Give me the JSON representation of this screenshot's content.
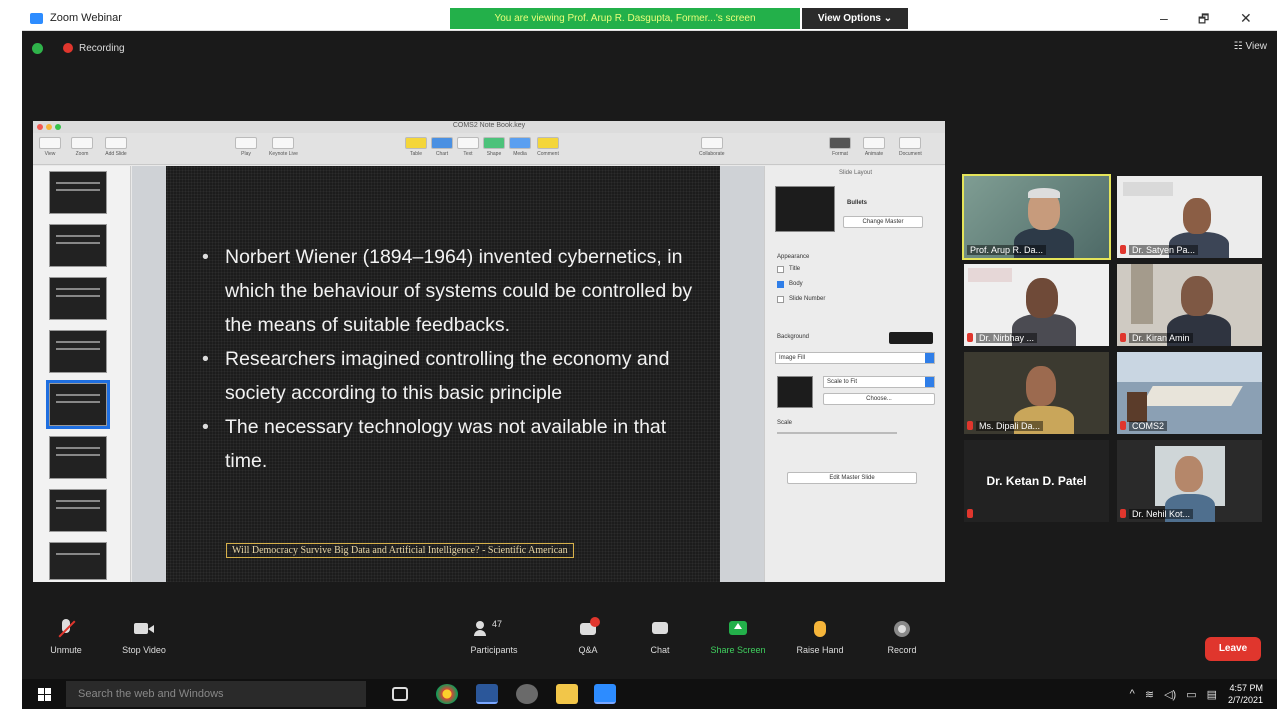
{
  "window": {
    "title": "Zoom Webinar",
    "banner": "You are viewing Prof. Arup R. Dasgupta, Former...'s screen",
    "view_options": "View Options ⌄",
    "minimize": "–",
    "maximize": "🗗",
    "close": "✕"
  },
  "status": {
    "recording": "Recording",
    "view": "☷ View"
  },
  "keynote": {
    "file_title": "COMS2 Note Book.key",
    "toolbar": [
      {
        "label": "View"
      },
      {
        "label": "Zoom"
      },
      {
        "label": "Add Slide"
      },
      {
        "label": "Play"
      },
      {
        "label": "Keynote Live"
      },
      {
        "label": "Table"
      },
      {
        "label": "Chart"
      },
      {
        "label": "Text"
      },
      {
        "label": "Shape"
      },
      {
        "label": "Media"
      },
      {
        "label": "Comment"
      },
      {
        "label": "Collaborate"
      },
      {
        "label": "Format"
      },
      {
        "label": "Animate"
      },
      {
        "label": "Document"
      }
    ],
    "slide": {
      "bullets": [
        "Norbert Wiener (1894–1964) invented cybernetics, in which the behaviour of systems could be controlled by the means of suitable feedbacks.",
        "Researchers imagined controlling the economy and society according to this basic principle",
        "The necessary technology was not available in that time."
      ],
      "citation": "Will Democracy Survive Big Data and Artificial Intelligence? - Scientific American"
    },
    "inspector": {
      "header": "Slide Layout",
      "master_name": "Bullets",
      "change_master": "Change Master",
      "appearance": "Appearance",
      "title": "Title",
      "body": "Body",
      "slide_number": "Slide Number",
      "background": "Background",
      "fill": "Image Fill",
      "scale": "Scale to Fit",
      "choose": "Choose...",
      "scale_label": "Scale",
      "edit_master": "Edit Master Slide"
    }
  },
  "participants": [
    {
      "name": "Prof. Arup R. Da..."
    },
    {
      "name": "Dr. Satyen Pa..."
    },
    {
      "name": "Dr. Nirbhay ..."
    },
    {
      "name": "Dr. Kiran Amin"
    },
    {
      "name": "Ms. Dipali Da..."
    },
    {
      "name": "COMS2"
    },
    {
      "name": "Dr. Ketan D. Patel"
    },
    {
      "name": "Dr. Nehil Kot..."
    }
  ],
  "controls": {
    "unmute": "Unmute",
    "stop_video": "Stop Video",
    "participants": "Participants",
    "participant_count": "47",
    "qa": "Q&A",
    "chat": "Chat",
    "share_screen": "Share Screen",
    "raise_hand": "Raise Hand",
    "record": "Record",
    "leave": "Leave"
  },
  "taskbar": {
    "search_placeholder": "Search the web and Windows",
    "time": "4:57 PM",
    "date": "2/7/2021"
  },
  "colors": {
    "zoom_blue": "#2d8cff",
    "banner_green": "#23b04a",
    "leave_red": "#e0362d",
    "share_green": "#23b04a"
  }
}
